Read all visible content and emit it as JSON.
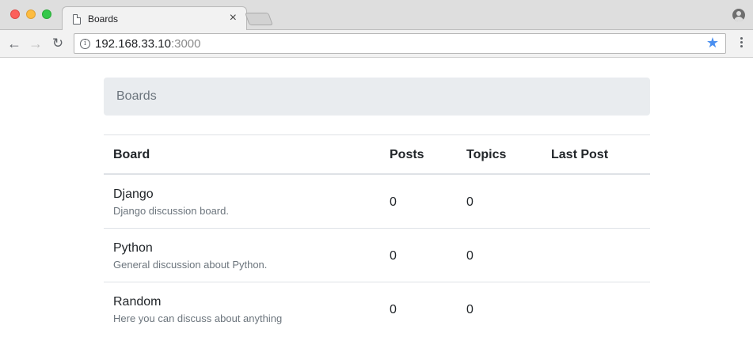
{
  "browser": {
    "tab": {
      "title": "Boards"
    },
    "address": {
      "host": "192.168.33.10",
      "port": ":3000"
    }
  },
  "breadcrumb": {
    "items": [
      "Boards"
    ]
  },
  "table": {
    "headers": {
      "board": "Board",
      "posts": "Posts",
      "topics": "Topics",
      "last_post": "Last Post"
    },
    "rows": [
      {
        "name": "Django",
        "description": "Django discussion board.",
        "posts": "0",
        "topics": "0",
        "last_post": ""
      },
      {
        "name": "Python",
        "description": "General discussion about Python.",
        "posts": "0",
        "topics": "0",
        "last_post": ""
      },
      {
        "name": "Random",
        "description": "Here you can discuss about anything",
        "posts": "0",
        "topics": "0",
        "last_post": ""
      }
    ]
  },
  "colors": {
    "breadcrumb_bg": "#e9ecef",
    "muted_text": "#6c757d",
    "star": "#4a8ff0"
  },
  "icons": [
    "page-icon",
    "tab-close-icon",
    "profile-icon",
    "back-arrow-icon",
    "forward-arrow-icon",
    "reload-icon",
    "info-icon",
    "star-icon",
    "menu-icon"
  ]
}
